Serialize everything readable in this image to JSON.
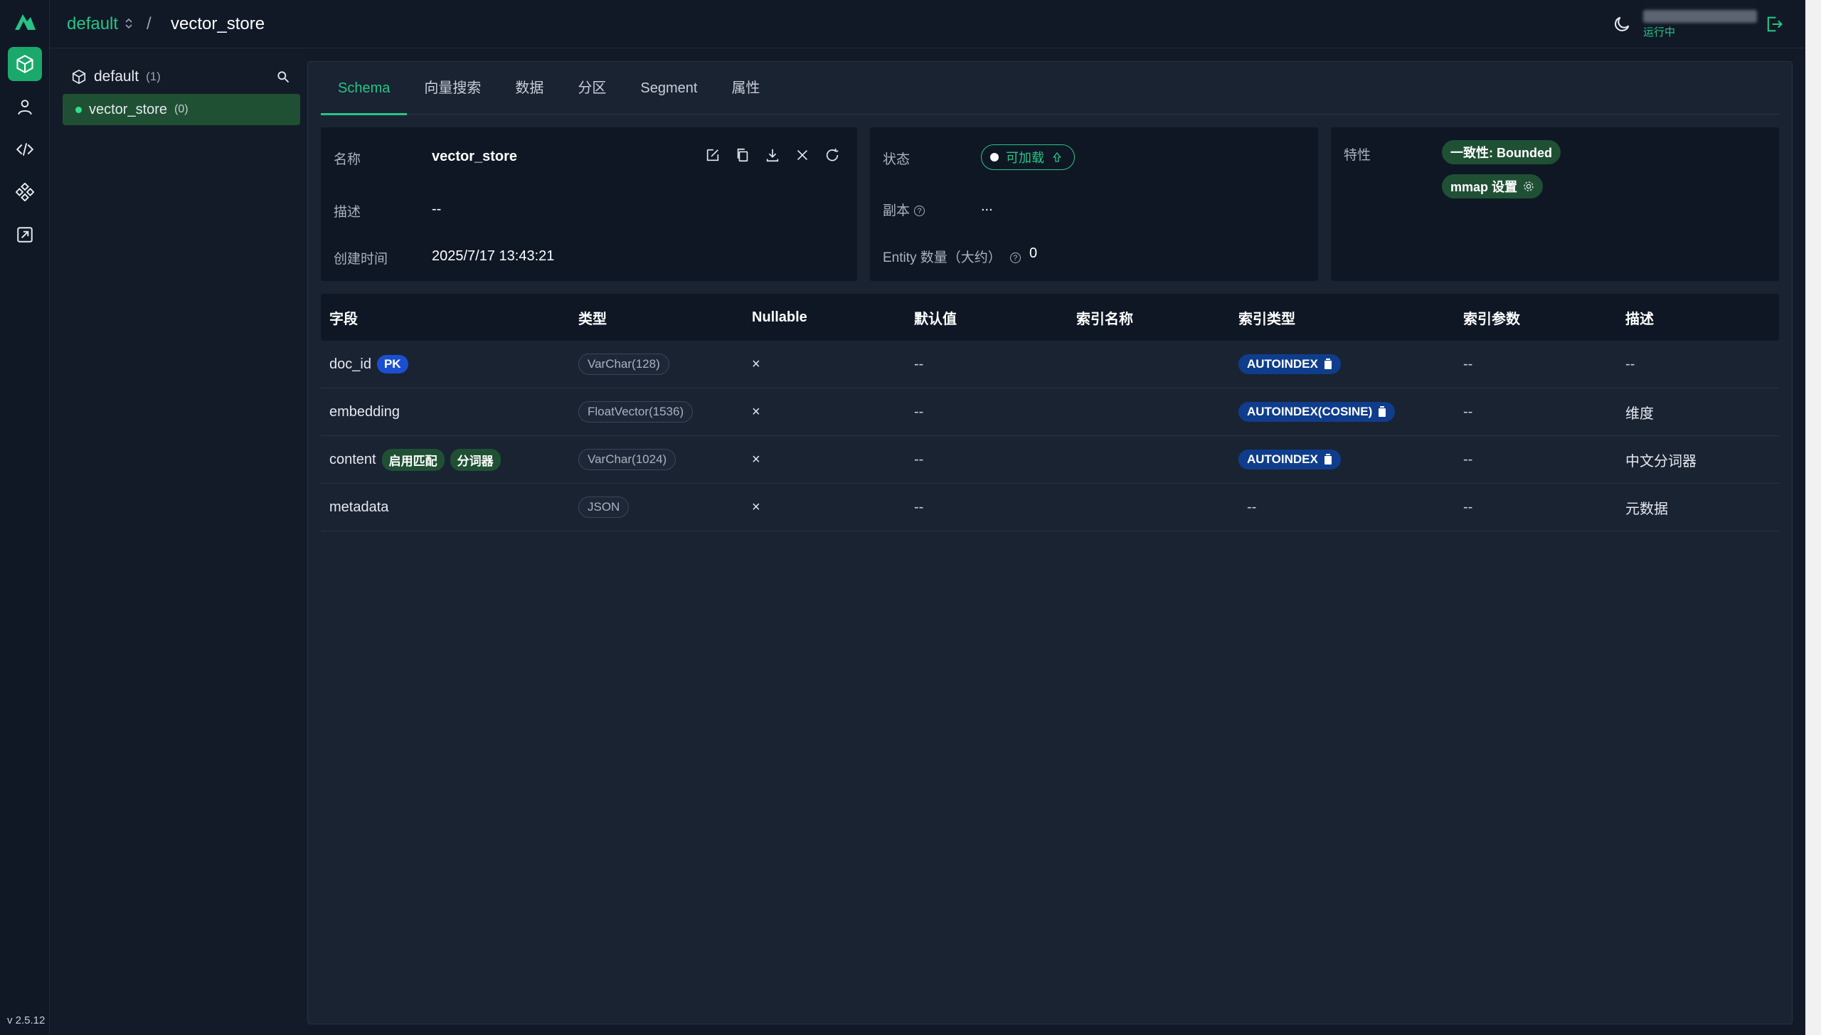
{
  "app": {
    "version": "v 2.5.12"
  },
  "header": {
    "database": "default",
    "separator": "/",
    "collection": "vector_store",
    "user_status": "运行中"
  },
  "tree": {
    "database_name": "default",
    "database_count": "(1)",
    "collection_name": "vector_store",
    "collection_count": "(0)"
  },
  "tabs": [
    "Schema",
    "向量搜索",
    "数据",
    "分区",
    "Segment",
    "属性"
  ],
  "info": {
    "name_label": "名称",
    "name": "vector_store",
    "desc_label": "描述",
    "desc": "--",
    "created_label": "创建时间",
    "created": "2025/7/17 13:43:21",
    "status_label": "状态",
    "status": "可加载",
    "replica_label": "副本",
    "replica": "...",
    "entity_label": "Entity 数量（大约）",
    "entity": "0",
    "features_label": "特性",
    "consistency": "一致性: Bounded",
    "mmap": "mmap 设置"
  },
  "table": {
    "headers": [
      "字段",
      "类型",
      "Nullable",
      "默认值",
      "索引名称",
      "索引类型",
      "索引参数",
      "描述"
    ],
    "rows": [
      {
        "field": "doc_id",
        "tags": [
          "PK"
        ],
        "type": "VarChar(128)",
        "nullable": "×",
        "default": "--",
        "index_name": "",
        "index_type": "AUTOINDEX",
        "params": "--",
        "desc": "--"
      },
      {
        "field": "embedding",
        "tags": [],
        "type": "FloatVector(1536)",
        "nullable": "×",
        "default": "--",
        "index_name": "",
        "index_type": "AUTOINDEX(COSINE)",
        "params": "--",
        "desc": "维度"
      },
      {
        "field": "content",
        "tags": [
          "启用匹配",
          "分词器"
        ],
        "type": "VarChar(1024)",
        "nullable": "×",
        "default": "--",
        "index_name": "",
        "index_type": "AUTOINDEX",
        "params": "--",
        "desc": "中文分词器"
      },
      {
        "field": "metadata",
        "tags": [],
        "type": "JSON",
        "nullable": "×",
        "default": "--",
        "index_name": "",
        "index_type": "--",
        "params": "--",
        "desc": "元数据"
      }
    ]
  }
}
